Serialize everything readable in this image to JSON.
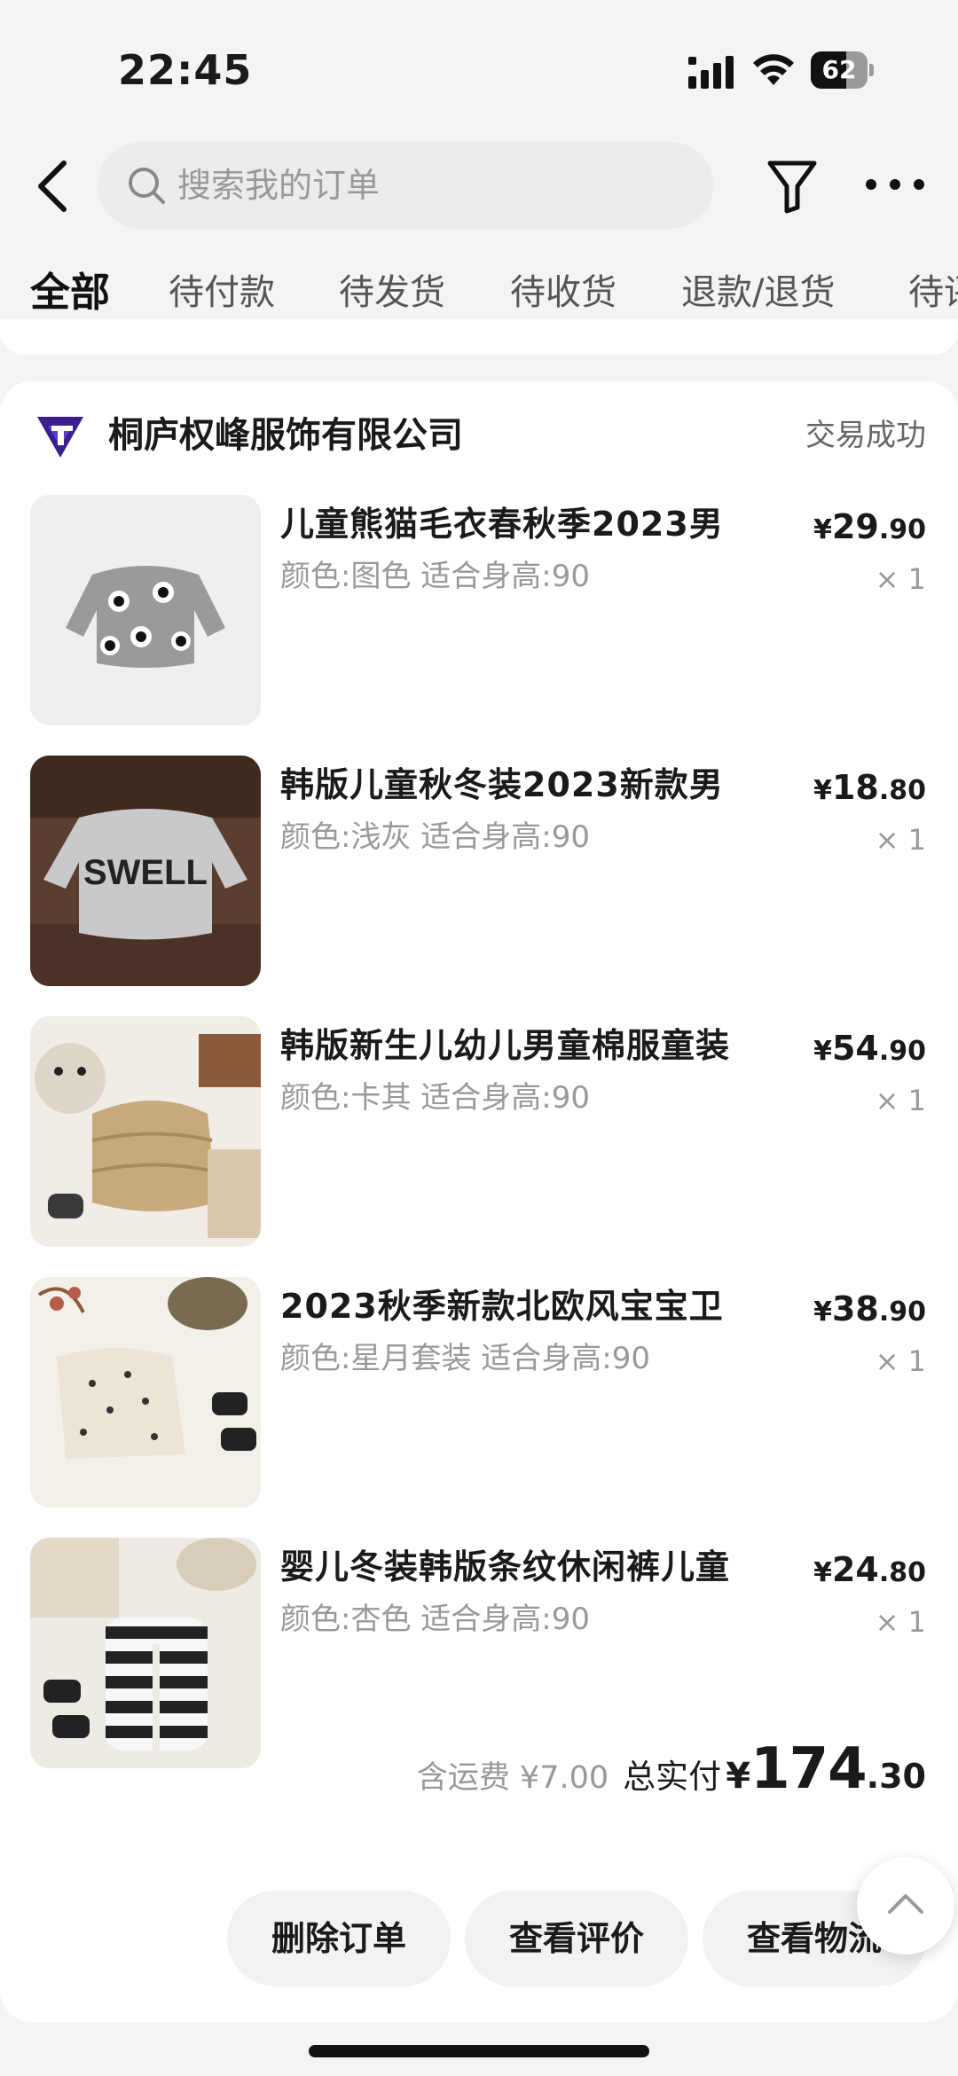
{
  "status_bar": {
    "time": "22:45",
    "battery": "62",
    "battery_level": 0.62
  },
  "header": {
    "search_placeholder": "搜索我的订单"
  },
  "tabs": [
    {
      "label": "全部",
      "active": true
    },
    {
      "label": "待付款",
      "active": false
    },
    {
      "label": "待发货",
      "active": false
    },
    {
      "label": "待收货",
      "active": false
    },
    {
      "label": "退款/退货",
      "active": false
    },
    {
      "label": "待评价",
      "active": false
    }
  ],
  "order": {
    "shop_name": "桐庐权峰服饰有限公司",
    "status": "交易成功",
    "items": [
      {
        "title": "儿童熊猫毛衣春秋季2023男",
        "spec": "颜色:图色 适合身高:90",
        "currency": "¥",
        "price_int": "29",
        "price_dec": ".90",
        "qty": "× 1"
      },
      {
        "title": "韩版儿童秋冬装2023新款男",
        "spec": "颜色:浅灰 适合身高:90",
        "currency": "¥",
        "price_int": "18",
        "price_dec": ".80",
        "qty": "× 1"
      },
      {
        "title": "韩版新生儿幼儿男童棉服童装",
        "spec": "颜色:卡其 适合身高:90",
        "currency": "¥",
        "price_int": "54",
        "price_dec": ".90",
        "qty": "× 1"
      },
      {
        "title": "2023秋季新款北欧风宝宝卫",
        "spec": "颜色:星月套装 适合身高:90",
        "currency": "¥",
        "price_int": "38",
        "price_dec": ".90",
        "qty": "× 1"
      },
      {
        "title": "婴儿冬装韩版条纹休闲裤儿童",
        "spec": "颜色:杏色 适合身高:90",
        "currency": "¥",
        "price_int": "24",
        "price_dec": ".80",
        "qty": "× 1"
      }
    ],
    "freight": "含运费 ¥7.00",
    "paid_label": "总实付",
    "total_currency": "¥",
    "total_int": "174",
    "total_dec": ".30",
    "buttons": {
      "delete": "删除订单",
      "review": "查看评价",
      "logistics": "查看物流"
    }
  },
  "icons": {
    "back": "back-arrow-icon",
    "search": "search-icon",
    "filter": "filter-icon",
    "more": "more-icon",
    "scroll_top": "chevron-up-icon"
  },
  "colors": {
    "shop_logo": "#3a1f8f",
    "background": "#f4f4f4"
  }
}
